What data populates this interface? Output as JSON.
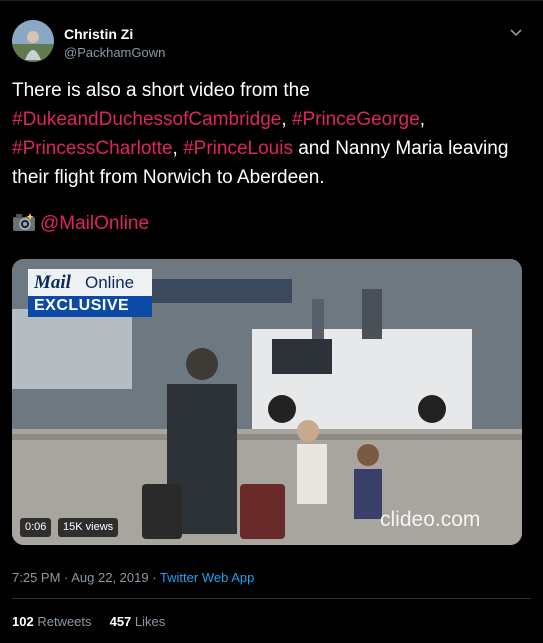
{
  "tweet": {
    "author_name": "Christin Zi",
    "author_handle": "@PackhamGown",
    "text_intro": "There is also a short video from the",
    "hashtag_1": "#DukeandDuchessofCambridge",
    "sep_1": ", ",
    "hashtag_2": "#PrinceGeorge",
    "sep_2": ",",
    "hashtag_3": "#PrincessCharlotte",
    "sep_3": ", ",
    "hashtag_4": "#PrinceLouis",
    "text_rest": " and Nanny Maria leaving their flight from Norwich to Aberdeen.",
    "mention": "@MailOnline",
    "timestamp": "7:25 PM · Aug 22, 2019 · ",
    "source": "Twitter Web App"
  },
  "media": {
    "logo_mail": "Mail",
    "logo_online": "Online",
    "exclusive_label": "EXCLUSIVE",
    "watermark": "clideo.com",
    "duration": "0:06",
    "views": "15K views"
  },
  "stats": {
    "retweets_count": "102",
    "retweets_label": "Retweets",
    "likes_count": "457",
    "likes_label": "Likes"
  },
  "colors": {
    "link": "#e0245e",
    "source_link": "#1da1f2",
    "secondary_text": "#8b98a5",
    "background": "#000000"
  },
  "icons": [
    "avatar",
    "chevron-down-icon",
    "camera-icon",
    "video-thumbnail"
  ]
}
